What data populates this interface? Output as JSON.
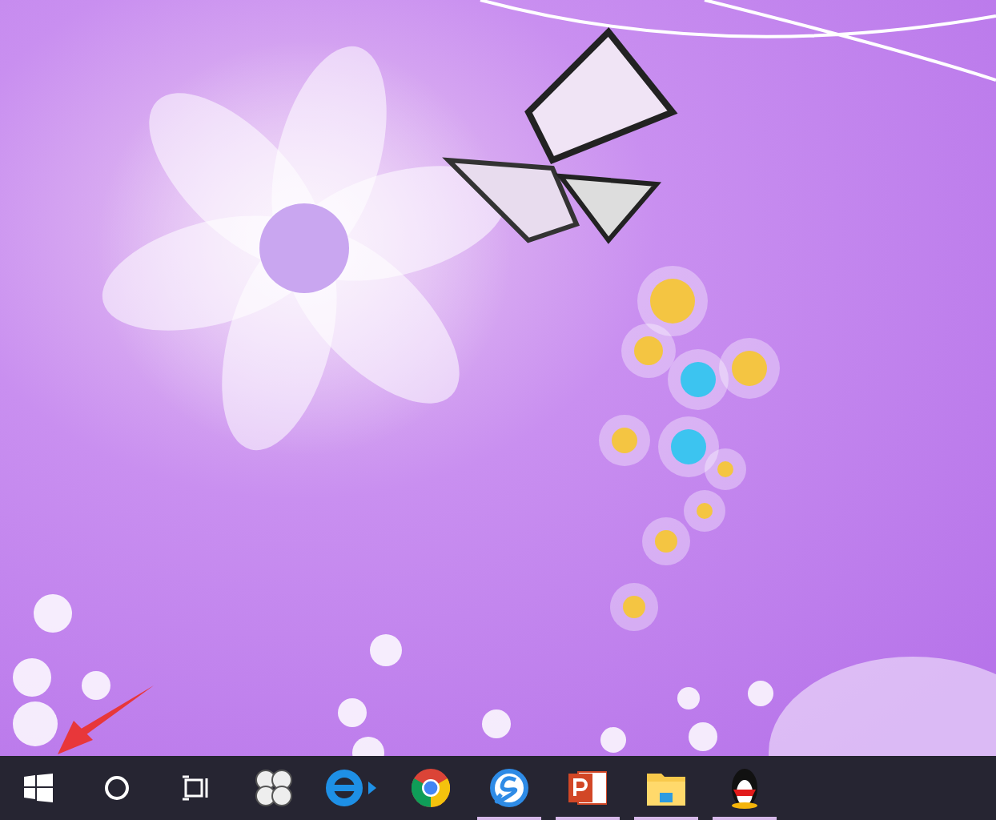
{
  "desktop": {
    "annotation": {
      "kind": "arrow"
    }
  },
  "taskbar": {
    "items": [
      {
        "kind": "start",
        "running": false
      },
      {
        "kind": "search",
        "running": false
      },
      {
        "kind": "taskview",
        "running": false
      },
      {
        "kind": "pinwheel",
        "running": false
      },
      {
        "kind": "ie",
        "running": false
      },
      {
        "kind": "chrome",
        "running": false
      },
      {
        "kind": "sogou",
        "running": true
      },
      {
        "kind": "powerpoint",
        "running": true
      },
      {
        "kind": "folder",
        "running": true
      },
      {
        "kind": "penguin",
        "running": true
      }
    ]
  }
}
